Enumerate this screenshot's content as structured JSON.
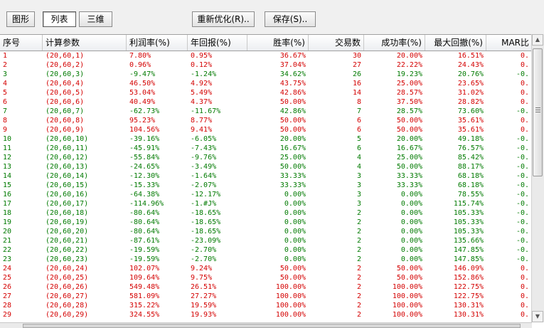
{
  "toolbar": {
    "tab_graph": "图形",
    "tab_list": "列表",
    "tab_3d": "三维",
    "reoptimize": "重新优化(R)..",
    "save": "保存(S).."
  },
  "columns": [
    "序号",
    "计算参数",
    "利润率(%)",
    "年回报(%)",
    "胜率(%)",
    "交易数",
    "成功率(%)",
    "最大回撤(%)",
    "MAR比"
  ],
  "colors": {
    "red": "#d40000",
    "green": "#007a00"
  },
  "rows": [
    {
      "idx": "1",
      "param": "(20,60,1)",
      "profit": "7.80%",
      "annual": "0.95%",
      "win": "36.67%",
      "trades": "30",
      "success": "20.00%",
      "drawdown": "16.51%",
      "mar": "0.",
      "color": "red"
    },
    {
      "idx": "2",
      "param": "(20,60,2)",
      "profit": "0.96%",
      "annual": "0.12%",
      "win": "37.04%",
      "trades": "27",
      "success": "22.22%",
      "drawdown": "24.43%",
      "mar": "0.",
      "color": "red"
    },
    {
      "idx": "3",
      "param": "(20,60,3)",
      "profit": "-9.47%",
      "annual": "-1.24%",
      "win": "34.62%",
      "trades": "26",
      "success": "19.23%",
      "drawdown": "20.76%",
      "mar": "-0.",
      "color": "green"
    },
    {
      "idx": "4",
      "param": "(20,60,4)",
      "profit": "46.50%",
      "annual": "4.92%",
      "win": "43.75%",
      "trades": "16",
      "success": "25.00%",
      "drawdown": "23.65%",
      "mar": "0.",
      "color": "red"
    },
    {
      "idx": "5",
      "param": "(20,60,5)",
      "profit": "53.04%",
      "annual": "5.49%",
      "win": "42.86%",
      "trades": "14",
      "success": "28.57%",
      "drawdown": "31.02%",
      "mar": "0.",
      "color": "red"
    },
    {
      "idx": "6",
      "param": "(20,60,6)",
      "profit": "40.49%",
      "annual": "4.37%",
      "win": "50.00%",
      "trades": "8",
      "success": "37.50%",
      "drawdown": "28.82%",
      "mar": "0.",
      "color": "red"
    },
    {
      "idx": "7",
      "param": "(20,60,7)",
      "profit": "-62.73%",
      "annual": "-11.67%",
      "win": "42.86%",
      "trades": "7",
      "success": "28.57%",
      "drawdown": "73.60%",
      "mar": "-0.",
      "color": "green"
    },
    {
      "idx": "8",
      "param": "(20,60,8)",
      "profit": "95.23%",
      "annual": "8.77%",
      "win": "50.00%",
      "trades": "6",
      "success": "50.00%",
      "drawdown": "35.61%",
      "mar": "0.",
      "color": "red"
    },
    {
      "idx": "9",
      "param": "(20,60,9)",
      "profit": "104.56%",
      "annual": "9.41%",
      "win": "50.00%",
      "trades": "6",
      "success": "50.00%",
      "drawdown": "35.61%",
      "mar": "0.",
      "color": "red"
    },
    {
      "idx": "10",
      "param": "(20,60,10)",
      "profit": "-39.16%",
      "annual": "-6.05%",
      "win": "20.00%",
      "trades": "5",
      "success": "20.00%",
      "drawdown": "49.18%",
      "mar": "-0.",
      "color": "green"
    },
    {
      "idx": "11",
      "param": "(20,60,11)",
      "profit": "-45.91%",
      "annual": "-7.43%",
      "win": "16.67%",
      "trades": "6",
      "success": "16.67%",
      "drawdown": "76.57%",
      "mar": "-0.",
      "color": "green"
    },
    {
      "idx": "12",
      "param": "(20,60,12)",
      "profit": "-55.84%",
      "annual": "-9.76%",
      "win": "25.00%",
      "trades": "4",
      "success": "25.00%",
      "drawdown": "85.42%",
      "mar": "-0.",
      "color": "green"
    },
    {
      "idx": "13",
      "param": "(20,60,13)",
      "profit": "-24.65%",
      "annual": "-3.49%",
      "win": "50.00%",
      "trades": "4",
      "success": "50.00%",
      "drawdown": "88.17%",
      "mar": "-0.",
      "color": "green"
    },
    {
      "idx": "14",
      "param": "(20,60,14)",
      "profit": "-12.30%",
      "annual": "-1.64%",
      "win": "33.33%",
      "trades": "3",
      "success": "33.33%",
      "drawdown": "68.18%",
      "mar": "-0.",
      "color": "green"
    },
    {
      "idx": "15",
      "param": "(20,60,15)",
      "profit": "-15.33%",
      "annual": "-2.07%",
      "win": "33.33%",
      "trades": "3",
      "success": "33.33%",
      "drawdown": "68.18%",
      "mar": "-0.",
      "color": "green"
    },
    {
      "idx": "16",
      "param": "(20,60,16)",
      "profit": "-64.38%",
      "annual": "-12.17%",
      "win": "0.00%",
      "trades": "3",
      "success": "0.00%",
      "drawdown": "78.55%",
      "mar": "-0.",
      "color": "green"
    },
    {
      "idx": "17",
      "param": "(20,60,17)",
      "profit": "-114.96%",
      "annual": "-1.#J%",
      "win": "0.00%",
      "trades": "3",
      "success": "0.00%",
      "drawdown": "115.74%",
      "mar": "-0.",
      "color": "green"
    },
    {
      "idx": "18",
      "param": "(20,60,18)",
      "profit": "-80.64%",
      "annual": "-18.65%",
      "win": "0.00%",
      "trades": "2",
      "success": "0.00%",
      "drawdown": "105.33%",
      "mar": "-0.",
      "color": "green"
    },
    {
      "idx": "19",
      "param": "(20,60,19)",
      "profit": "-80.64%",
      "annual": "-18.65%",
      "win": "0.00%",
      "trades": "2",
      "success": "0.00%",
      "drawdown": "105.33%",
      "mar": "-0.",
      "color": "green"
    },
    {
      "idx": "20",
      "param": "(20,60,20)",
      "profit": "-80.64%",
      "annual": "-18.65%",
      "win": "0.00%",
      "trades": "2",
      "success": "0.00%",
      "drawdown": "105.33%",
      "mar": "-0.",
      "color": "green"
    },
    {
      "idx": "21",
      "param": "(20,60,21)",
      "profit": "-87.61%",
      "annual": "-23.09%",
      "win": "0.00%",
      "trades": "2",
      "success": "0.00%",
      "drawdown": "135.66%",
      "mar": "-0.",
      "color": "green"
    },
    {
      "idx": "22",
      "param": "(20,60,22)",
      "profit": "-19.59%",
      "annual": "-2.70%",
      "win": "0.00%",
      "trades": "2",
      "success": "0.00%",
      "drawdown": "147.85%",
      "mar": "-0.",
      "color": "green"
    },
    {
      "idx": "23",
      "param": "(20,60,23)",
      "profit": "-19.59%",
      "annual": "-2.70%",
      "win": "0.00%",
      "trades": "2",
      "success": "0.00%",
      "drawdown": "147.85%",
      "mar": "-0.",
      "color": "green"
    },
    {
      "idx": "24",
      "param": "(20,60,24)",
      "profit": "102.07%",
      "annual": "9.24%",
      "win": "50.00%",
      "trades": "2",
      "success": "50.00%",
      "drawdown": "146.09%",
      "mar": "0.",
      "color": "red"
    },
    {
      "idx": "25",
      "param": "(20,60,25)",
      "profit": "109.64%",
      "annual": "9.75%",
      "win": "50.00%",
      "trades": "2",
      "success": "50.00%",
      "drawdown": "152.86%",
      "mar": "0.",
      "color": "red"
    },
    {
      "idx": "26",
      "param": "(20,60,26)",
      "profit": "549.48%",
      "annual": "26.51%",
      "win": "100.00%",
      "trades": "2",
      "success": "100.00%",
      "drawdown": "122.75%",
      "mar": "0.",
      "color": "red"
    },
    {
      "idx": "27",
      "param": "(20,60,27)",
      "profit": "581.09%",
      "annual": "27.27%",
      "win": "100.00%",
      "trades": "2",
      "success": "100.00%",
      "drawdown": "122.75%",
      "mar": "0.",
      "color": "red"
    },
    {
      "idx": "28",
      "param": "(20,60,28)",
      "profit": "315.22%",
      "annual": "19.59%",
      "win": "100.00%",
      "trades": "2",
      "success": "100.00%",
      "drawdown": "130.31%",
      "mar": "0.",
      "color": "red"
    },
    {
      "idx": "29",
      "param": "(20,60,29)",
      "profit": "324.55%",
      "annual": "19.93%",
      "win": "100.00%",
      "trades": "2",
      "success": "100.00%",
      "drawdown": "130.31%",
      "mar": "0.",
      "color": "red"
    }
  ]
}
